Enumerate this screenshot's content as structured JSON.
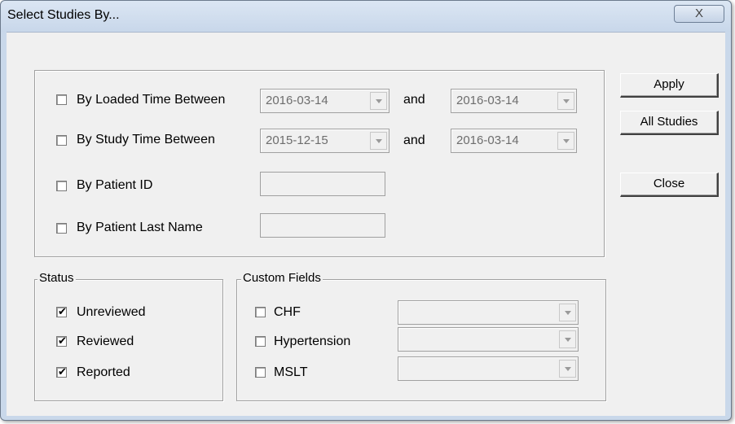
{
  "window": {
    "title": "Select Studies By...",
    "close_glyph": "X"
  },
  "filters": {
    "loaded_time": {
      "label": "By Loaded Time Between",
      "checked": false,
      "from": "2016-03-14",
      "and_label": "and",
      "to": "2016-03-14"
    },
    "study_time": {
      "label": "By Study Time Between",
      "checked": false,
      "from": "2015-12-15",
      "and_label": "and",
      "to": "2016-03-14"
    },
    "patient_id": {
      "label": "By Patient ID",
      "checked": false,
      "value": ""
    },
    "patient_last_name": {
      "label": "By Patient Last Name",
      "checked": false,
      "value": ""
    }
  },
  "buttons": {
    "apply": "Apply",
    "all_studies": "All Studies",
    "close": "Close"
  },
  "status": {
    "legend": "Status",
    "items": [
      {
        "label": "Unreviewed",
        "checked": true
      },
      {
        "label": "Reviewed",
        "checked": true
      },
      {
        "label": "Reported",
        "checked": true
      }
    ]
  },
  "custom_fields": {
    "legend": "Custom Fields",
    "items": [
      {
        "label": "CHF",
        "checked": false,
        "value": ""
      },
      {
        "label": "Hypertension",
        "checked": false,
        "value": ""
      },
      {
        "label": "MSLT",
        "checked": false,
        "value": ""
      }
    ]
  },
  "check_glyph": "✔"
}
